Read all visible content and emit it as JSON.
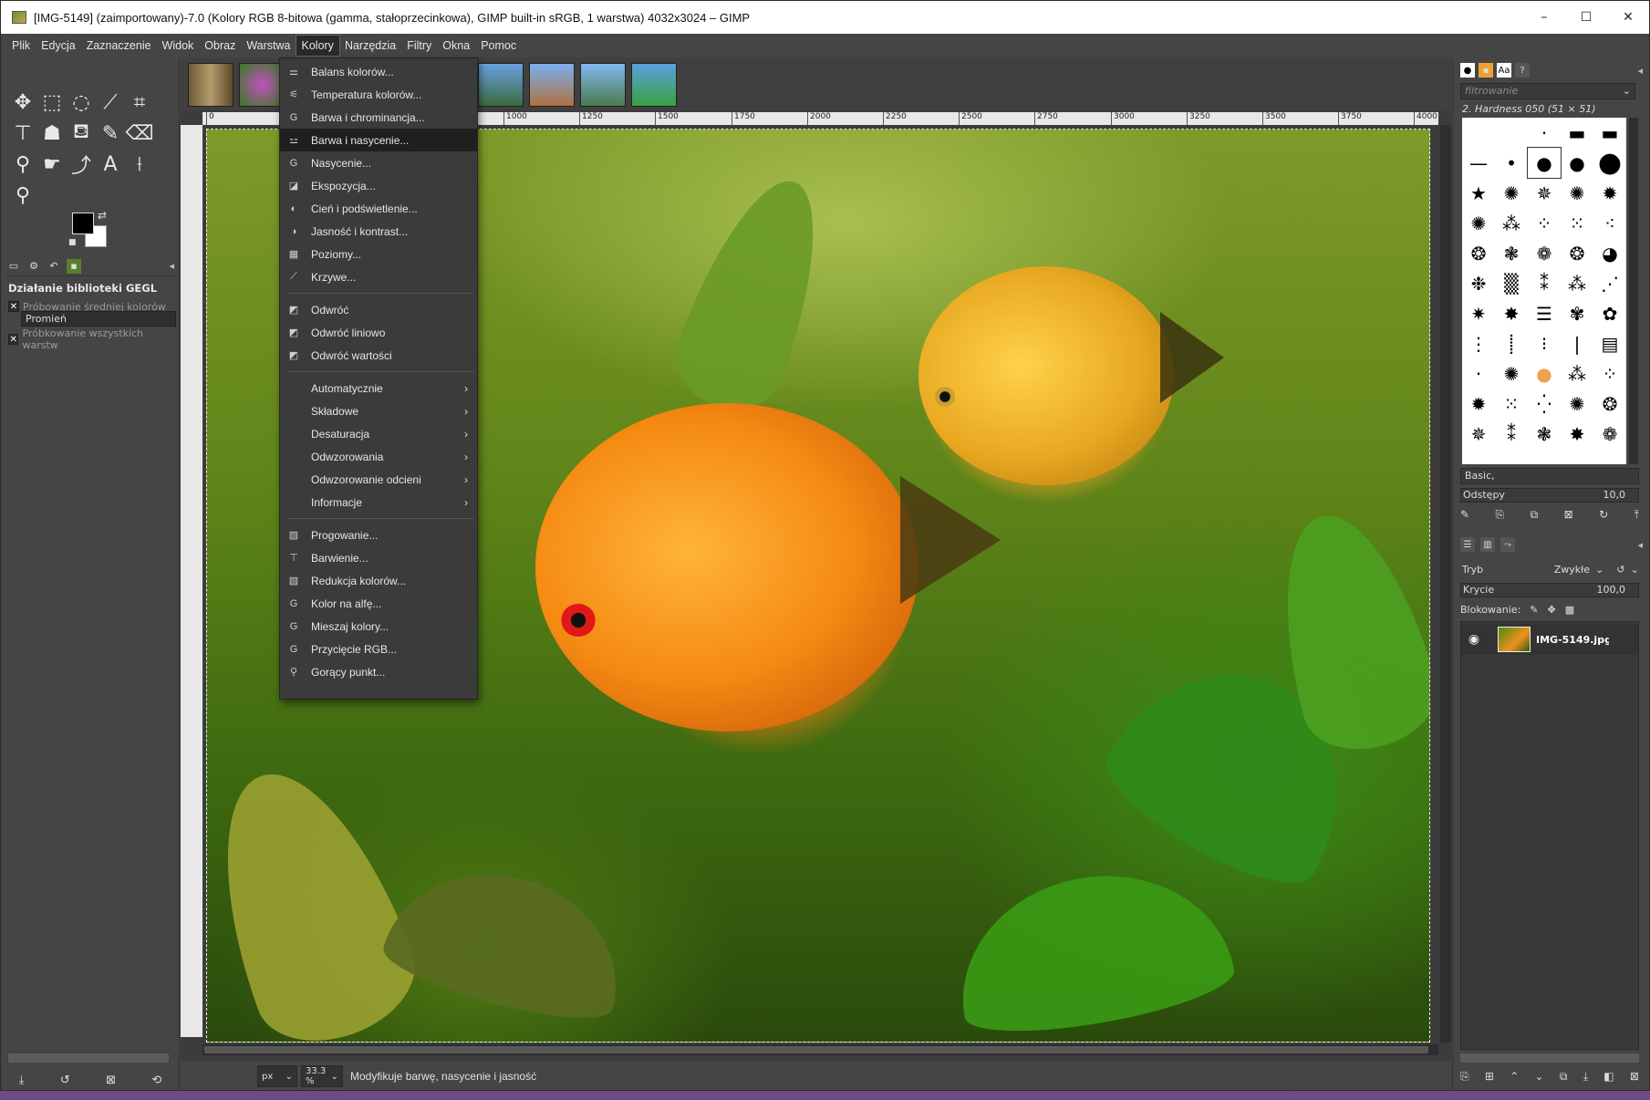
{
  "window": {
    "title": "[IMG-5149] (zaimportowany)-7.0 (Kolory RGB 8-bitowa (gamma, stałoprzecinkowa), GIMP built-in sRGB, 1 warstwa) 4032x3024 – GIMP",
    "minimize": "–",
    "maximize": "☐",
    "close": "✕"
  },
  "menubar": {
    "items": [
      "Plik",
      "Edycja",
      "Zaznaczenie",
      "Widok",
      "Obraz",
      "Warstwa",
      "Kolory",
      "Narzędzia",
      "Filtry",
      "Okna",
      "Pomoc"
    ],
    "active": "Kolory"
  },
  "colors_menu": {
    "items": [
      {
        "label": "Balans kolorów...",
        "icon": "color-balance-icon"
      },
      {
        "label": "Temperatura kolorów...",
        "icon": "color-temperature-icon"
      },
      {
        "label": "Barwa i chrominancja...",
        "icon": "gegl-icon"
      },
      {
        "label": "Barwa i nasycenie...",
        "icon": "hue-saturation-icon",
        "highlighted": true
      },
      {
        "label": "Nasycenie...",
        "icon": "gegl-icon"
      },
      {
        "label": "Ekspozycja...",
        "icon": "exposure-icon"
      },
      {
        "label": "Cień i podświetlenie...",
        "icon": "shadows-highlights-icon"
      },
      {
        "label": "Jasność i kontrast...",
        "icon": "brightness-contrast-icon"
      },
      {
        "label": "Poziomy...",
        "icon": "levels-icon"
      },
      {
        "label": "Krzywe...",
        "icon": "curves-icon"
      },
      {
        "label": "Odwróć",
        "icon": "invert-icon"
      },
      {
        "label": "Odwróć liniowo",
        "icon": "invert-icon"
      },
      {
        "label": "Odwróć wartości",
        "icon": "invert-icon"
      },
      {
        "label": "Automatycznie",
        "submenu": true
      },
      {
        "label": "Składowe",
        "submenu": true
      },
      {
        "label": "Desaturacja",
        "submenu": true
      },
      {
        "label": "Odwzorowania",
        "submenu": true
      },
      {
        "label": "Odwzorowanie odcieni",
        "submenu": true
      },
      {
        "label": "Informacje",
        "submenu": true
      },
      {
        "label": "Progowanie...",
        "icon": "threshold-icon"
      },
      {
        "label": "Barwienie...",
        "icon": "colorize-icon"
      },
      {
        "label": "Redukcja kolorów...",
        "icon": "posterize-icon"
      },
      {
        "label": "Kolor na alfę...",
        "icon": "gegl-icon"
      },
      {
        "label": "Mieszaj kolory...",
        "icon": "gegl-icon"
      },
      {
        "label": "Przycięcie RGB...",
        "icon": "gegl-icon"
      },
      {
        "label": "Gorący punkt...",
        "icon": "hot-spot-icon"
      }
    ]
  },
  "tool_options": {
    "title": "Działanie biblioteki GEGL",
    "sample_average": "Próbowanie średniej kolorów",
    "radius_label": "Promień",
    "sample_merged": "Próbkowanie wszystkich warstw"
  },
  "ruler": {
    "ticks": [
      "0",
      "1000",
      "1250",
      "1500",
      "1750",
      "2000",
      "2250",
      "2500",
      "2750",
      "3000",
      "3250",
      "3500",
      "3750",
      "4000"
    ]
  },
  "statusbar": {
    "unit": "px",
    "zoom": "33.3 %",
    "message": "Modyfikuje barwę, nasycenie i jasność"
  },
  "brushes": {
    "filter_placeholder": "filtrowanie",
    "selected_brush": "2. Hardness 050 (51 × 51)",
    "preset": "Basic,",
    "spacing_label": "Odstępy",
    "spacing_value": "10,0"
  },
  "layers": {
    "mode_label": "Tryb",
    "mode_value": "Zwykłe",
    "opacity_label": "Krycie",
    "opacity_value": "100,0",
    "lock_label": "Blokowanie:",
    "layer_name": "IMG-5149.jpg"
  }
}
